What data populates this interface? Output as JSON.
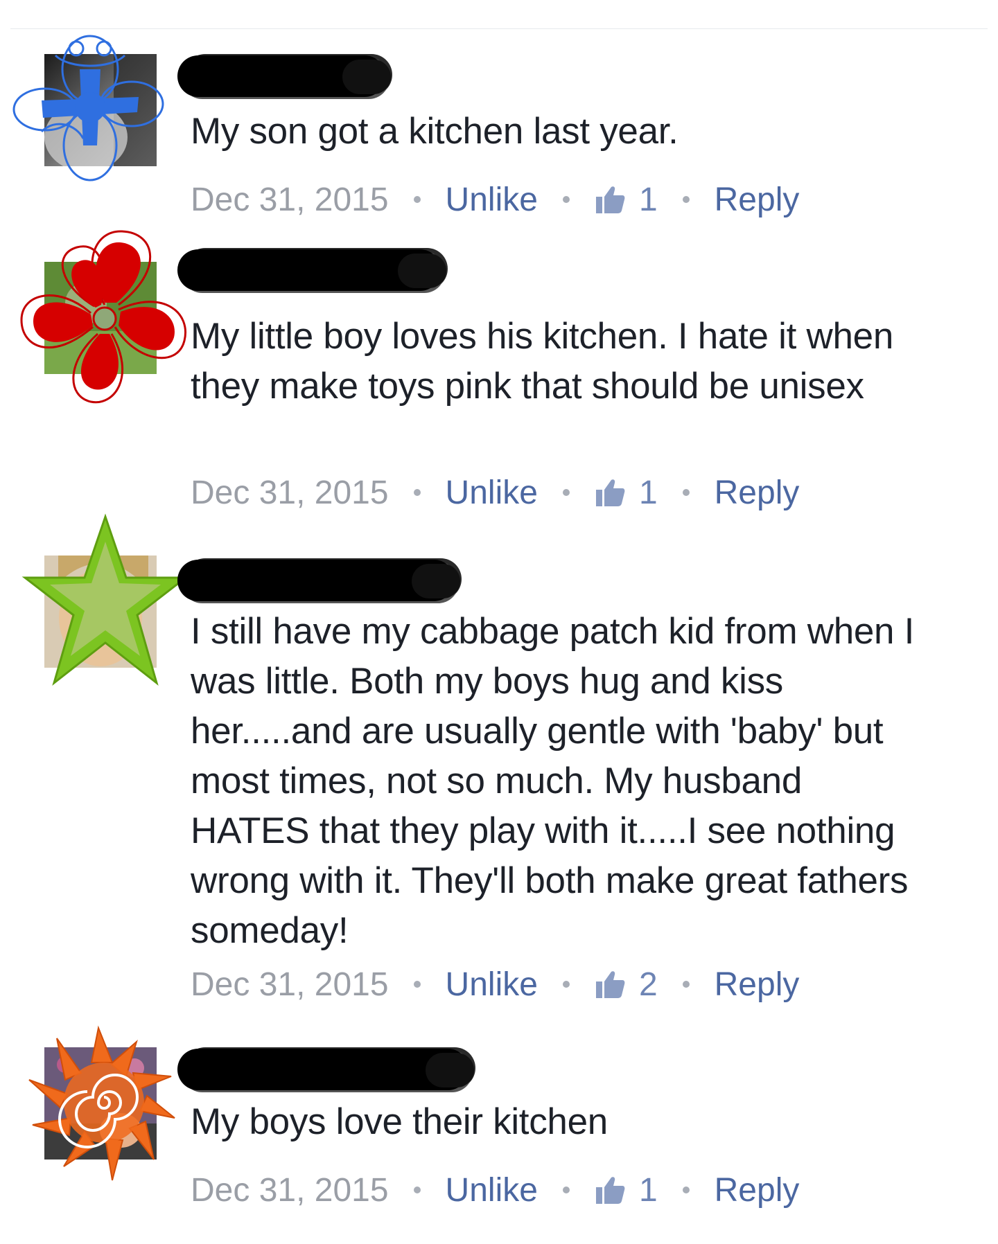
{
  "comments": [
    {
      "text": "My son got a kitchen last year.",
      "date": "Dec 31, 2015",
      "action_label": "Unlike",
      "like_count": "1",
      "reply_label": "Reply",
      "doodle": "flower-outline-icon",
      "doodle_color": "#2f6fe0"
    },
    {
      "text": "My little boy loves his kitchen. I hate it when they make toys pink that should be unisex",
      "date": "Dec 31, 2015",
      "action_label": "Unlike",
      "like_count": "1",
      "reply_label": "Reply",
      "doodle": "flower-filled-icon",
      "doodle_color": "#d60000"
    },
    {
      "text": "I still have my cabbage patch kid from when I was little. Both my boys hug and kiss her.....and are usually gentle with 'baby' but most times, not so much. My husband HATES that they play with it.....I see nothing wrong with it. They'll both make great fathers someday!",
      "date": "Dec 31, 2015",
      "action_label": "Unlike",
      "like_count": "2",
      "reply_label": "Reply",
      "doodle": "star-icon",
      "doodle_color": "#7cc421"
    },
    {
      "text": "My boys love their kitchen",
      "date": "Dec 31, 2015",
      "action_label": "Unlike",
      "like_count": "1",
      "reply_label": "Reply",
      "doodle": "sun-spiral-icon",
      "doodle_color": "#f06a1c"
    }
  ],
  "colors": {
    "text": "#1d2129",
    "meta_gray": "#90949c",
    "link_blue": "#4b67a1",
    "like_icon": "#8b9dc3"
  }
}
